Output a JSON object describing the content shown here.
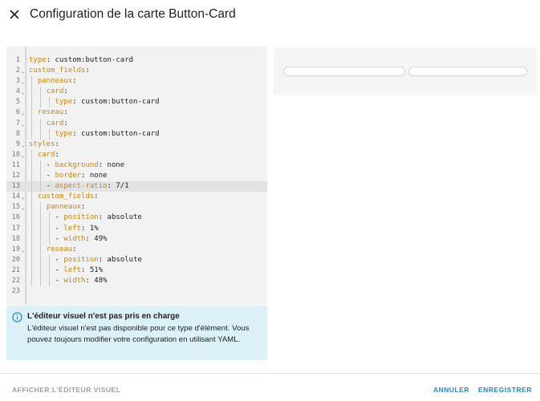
{
  "dialog": {
    "title": "Configuration de la carte Button-Card"
  },
  "editor": {
    "active_line": 13,
    "lines": [
      {
        "n": "1",
        "fold": false,
        "depth": 0,
        "indent": "",
        "key": "type",
        "rest": ": custom:button-card"
      },
      {
        "n": "2",
        "fold": true,
        "depth": 0,
        "indent": "",
        "key": "custom_fields",
        "rest": ":"
      },
      {
        "n": "3",
        "fold": true,
        "depth": 1,
        "indent": "  ",
        "key": "panneaux",
        "rest": ":"
      },
      {
        "n": "4",
        "fold": true,
        "depth": 2,
        "indent": "    ",
        "key": "card",
        "rest": ":"
      },
      {
        "n": "5",
        "fold": false,
        "depth": 3,
        "indent": "      ",
        "key": "type",
        "rest": ": custom:button-card"
      },
      {
        "n": "6",
        "fold": true,
        "depth": 1,
        "indent": "  ",
        "key": "reseau",
        "rest": ":"
      },
      {
        "n": "7",
        "fold": true,
        "depth": 2,
        "indent": "    ",
        "key": "card",
        "rest": ":"
      },
      {
        "n": "8",
        "fold": false,
        "depth": 3,
        "indent": "      ",
        "key": "type",
        "rest": ": custom:button-card"
      },
      {
        "n": "9",
        "fold": true,
        "depth": 0,
        "indent": "",
        "key": "styles",
        "rest": ":"
      },
      {
        "n": "10",
        "fold": true,
        "depth": 1,
        "indent": "  ",
        "key": "card",
        "rest": ":"
      },
      {
        "n": "11",
        "fold": false,
        "depth": 2,
        "indent": "    - ",
        "key": "background",
        "rest": ": none"
      },
      {
        "n": "12",
        "fold": false,
        "depth": 2,
        "indent": "    - ",
        "key": "border",
        "rest": ": none"
      },
      {
        "n": "13",
        "fold": false,
        "depth": 2,
        "indent": "    - ",
        "key": "aspect-ratio",
        "rest": ": 7/1"
      },
      {
        "n": "14",
        "fold": true,
        "depth": 1,
        "indent": "  ",
        "key": "custom_fields",
        "rest": ":"
      },
      {
        "n": "15",
        "fold": true,
        "depth": 2,
        "indent": "    ",
        "key": "panneaux",
        "rest": ":"
      },
      {
        "n": "16",
        "fold": false,
        "depth": 3,
        "indent": "      - ",
        "key": "position",
        "rest": ": absolute"
      },
      {
        "n": "17",
        "fold": false,
        "depth": 3,
        "indent": "      - ",
        "key": "left",
        "rest": ": 1%"
      },
      {
        "n": "18",
        "fold": false,
        "depth": 3,
        "indent": "      - ",
        "key": "width",
        "rest": ": 49%"
      },
      {
        "n": "19",
        "fold": true,
        "depth": 2,
        "indent": "    ",
        "key": "reseau",
        "rest": ":"
      },
      {
        "n": "20",
        "fold": false,
        "depth": 3,
        "indent": "      - ",
        "key": "position",
        "rest": ": absolute"
      },
      {
        "n": "21",
        "fold": false,
        "depth": 3,
        "indent": "      - ",
        "key": "left",
        "rest": ": 51%"
      },
      {
        "n": "22",
        "fold": false,
        "depth": 3,
        "indent": "      - ",
        "key": "width",
        "rest": ": 48%"
      },
      {
        "n": "23",
        "fold": false,
        "depth": 0,
        "indent": "",
        "key": "",
        "rest": ""
      }
    ]
  },
  "info": {
    "title": "L'éditeur visuel n'est pas pris en charge",
    "body": "L'éditeur visuel n'est pas disponible pour ce type d'élément. Vous pouvez toujours modifier votre configuration en utilisant YAML."
  },
  "footer": {
    "visual_editor": "AFFICHER L'ÉDITEUR VISUEL",
    "cancel": "ANNULER",
    "save": "ENREGISTRER"
  },
  "colors": {
    "accent": "#1e88c8",
    "yaml_key": "#d1850a",
    "info_bg": "#dcf0f8"
  },
  "icons": {
    "close": "close-icon",
    "info": "info-icon",
    "fold": "fold-chevron-icon"
  }
}
